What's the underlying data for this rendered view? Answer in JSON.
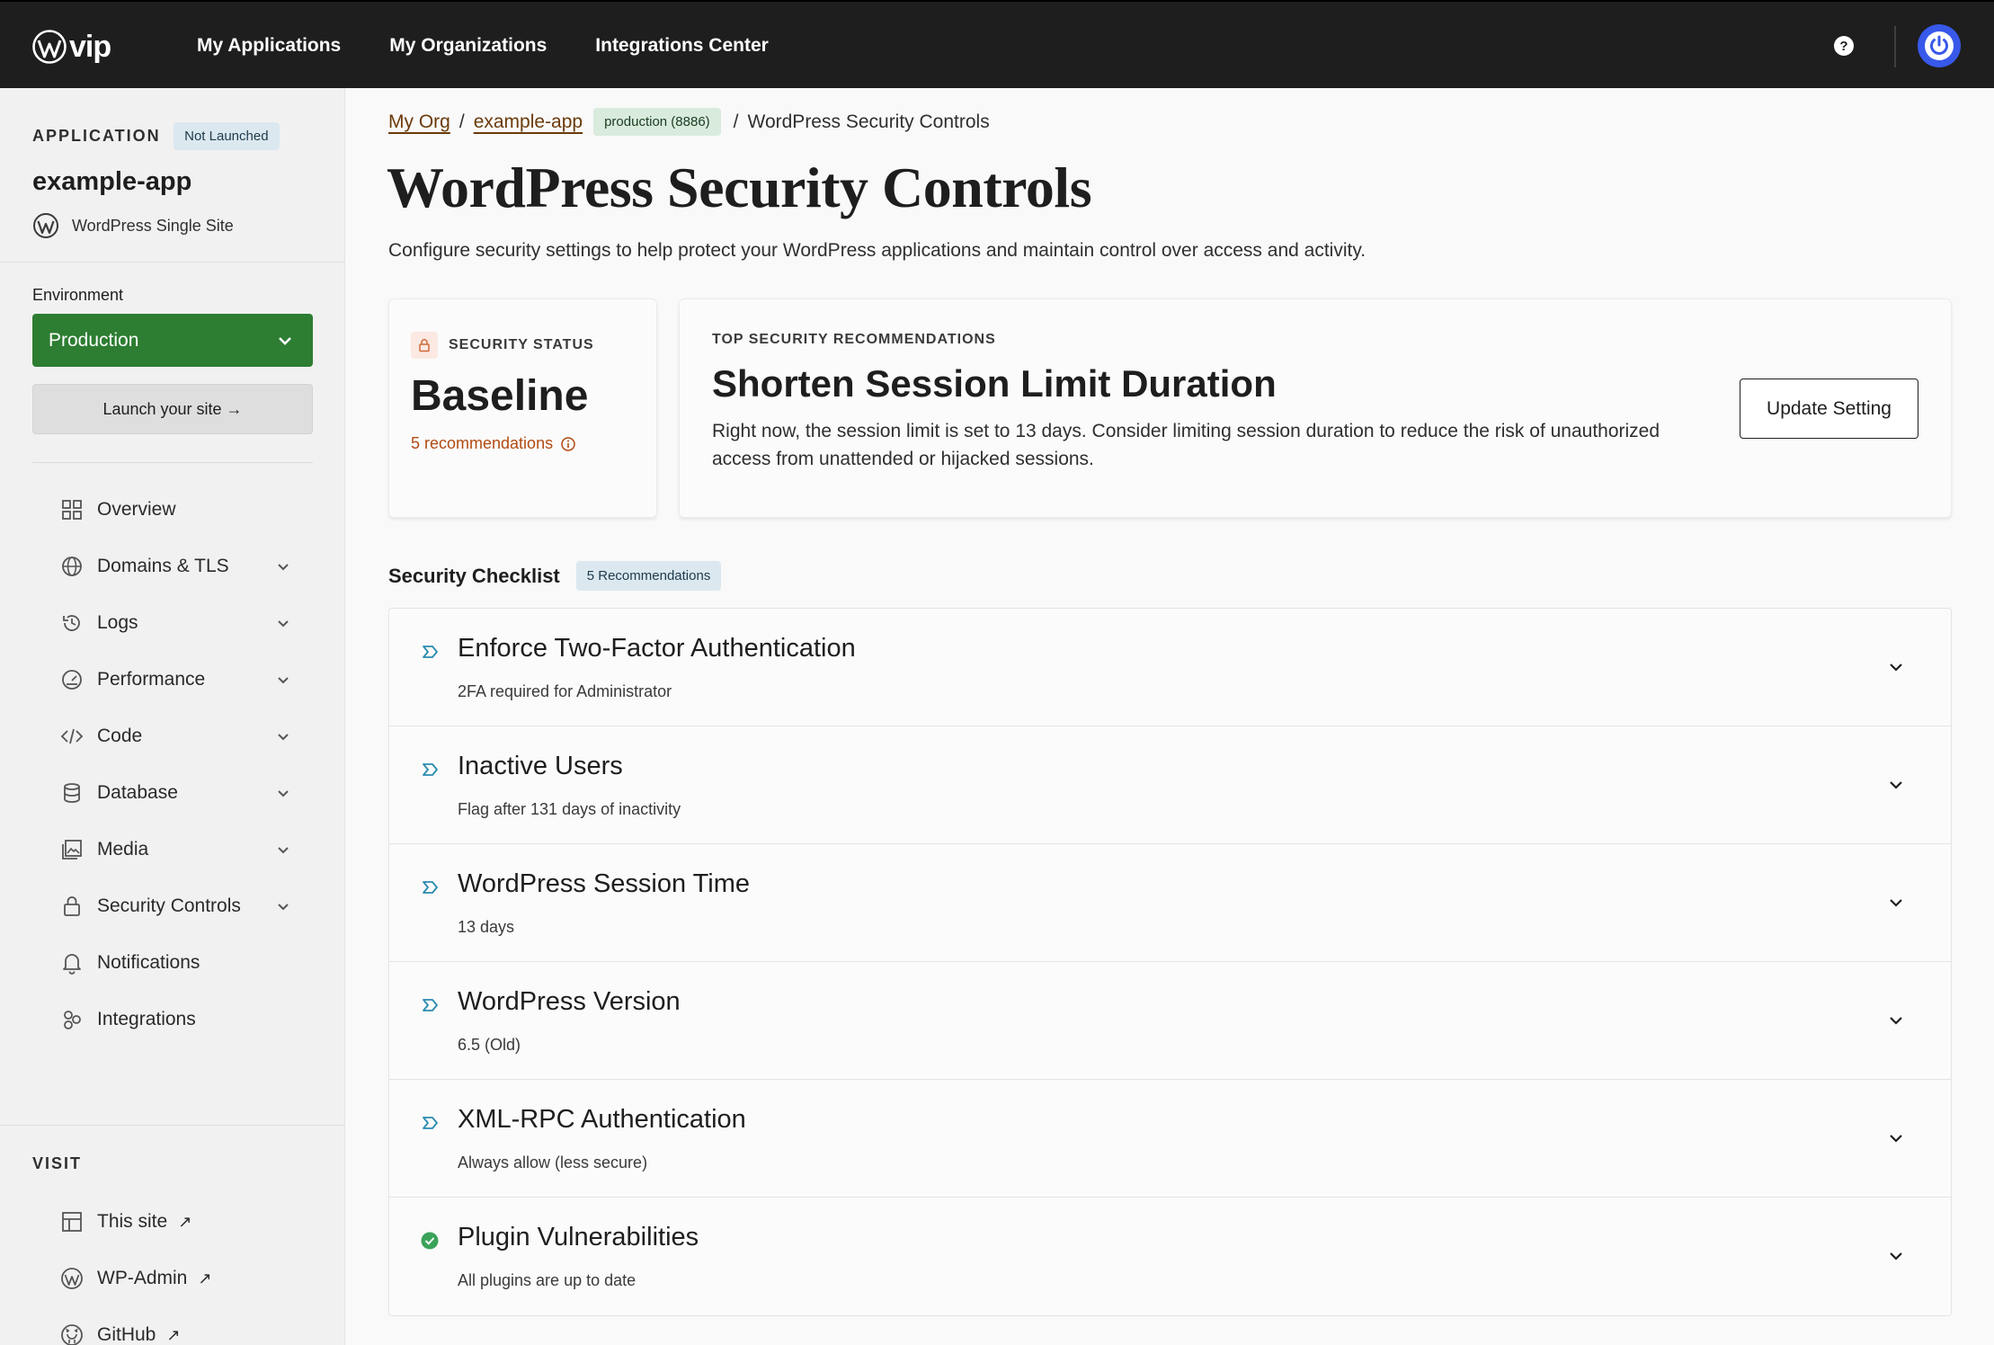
{
  "topbar": {
    "logo_text": "vip",
    "nav": [
      "My Applications",
      "My Organizations",
      "Integrations Center"
    ],
    "help_label": "?"
  },
  "sidebar": {
    "eyebrow": "APPLICATION",
    "status_badge": "Not Launched",
    "app_name": "example-app",
    "site_type": "WordPress Single Site",
    "environment_label": "Environment",
    "environment_value": "Production",
    "launch_label": "Launch your site →",
    "nav_items": [
      {
        "label": "Overview",
        "icon": "grid-icon",
        "expandable": false
      },
      {
        "label": "Domains & TLS",
        "icon": "globe-icon",
        "expandable": true
      },
      {
        "label": "Logs",
        "icon": "history-icon",
        "expandable": true
      },
      {
        "label": "Performance",
        "icon": "gauge-icon",
        "expandable": true
      },
      {
        "label": "Code",
        "icon": "code-icon",
        "expandable": true
      },
      {
        "label": "Database",
        "icon": "database-icon",
        "expandable": true
      },
      {
        "label": "Media",
        "icon": "media-icon",
        "expandable": true
      },
      {
        "label": "Security Controls",
        "icon": "lock-icon",
        "expandable": true
      },
      {
        "label": "Notifications",
        "icon": "bell-icon",
        "expandable": false
      },
      {
        "label": "Integrations",
        "icon": "integrations-icon",
        "expandable": false
      }
    ],
    "visit_label": "VISIT",
    "visit_items": [
      {
        "label": "This site",
        "icon": "layout-icon"
      },
      {
        "label": "WP-Admin",
        "icon": "wordpress-icon"
      },
      {
        "label": "GitHub",
        "icon": "github-icon"
      }
    ],
    "external_arrow": "↗"
  },
  "breadcrumb": {
    "org": "My Org",
    "app": "example-app",
    "env": "production (8886)",
    "current": "WordPress Security Controls",
    "separator": "/"
  },
  "page": {
    "title": "WordPress Security Controls",
    "description": "Configure security settings to help protect your WordPress applications and maintain control over access and activity."
  },
  "status_card": {
    "eyebrow": "SECURITY STATUS",
    "value": "Baseline",
    "recommendations": "5 recommendations"
  },
  "recommendation_card": {
    "eyebrow": "TOP SECURITY RECOMMENDATIONS",
    "title": "Shorten Session Limit Duration",
    "body": "Right now, the session limit is set to 13 days. Consider limiting session duration to reduce the risk of unauthorized access from unattended or hijacked sessions.",
    "button_label": "Update Setting"
  },
  "checklist": {
    "title": "Security Checklist",
    "badge": "5 Recommendations",
    "items": [
      {
        "title": "Enforce Two-Factor Authentication",
        "subtitle": "2FA required for Administrator",
        "status": "recommendation"
      },
      {
        "title": "Inactive Users",
        "subtitle": "Flag after 131 days of inactivity",
        "status": "recommendation"
      },
      {
        "title": "WordPress Session Time",
        "subtitle": "13 days",
        "status": "recommendation"
      },
      {
        "title": "WordPress Version",
        "subtitle": "6.5 (Old)",
        "status": "recommendation"
      },
      {
        "title": "XML-RPC Authentication",
        "subtitle": "Always allow (less secure)",
        "status": "recommendation"
      },
      {
        "title": "Plugin Vulnerabilities",
        "subtitle": "All plugins are up to date",
        "status": "ok"
      }
    ]
  },
  "colors": {
    "topbar": "#1e1e1e",
    "env_green": "#2d7d32",
    "link_brown": "#6b3a0a",
    "recs_orange": "#b04a12",
    "rec_icon_teal": "#2a8bb0",
    "ok_green": "#3aa35a",
    "avatar_blue": "#3858e9"
  }
}
